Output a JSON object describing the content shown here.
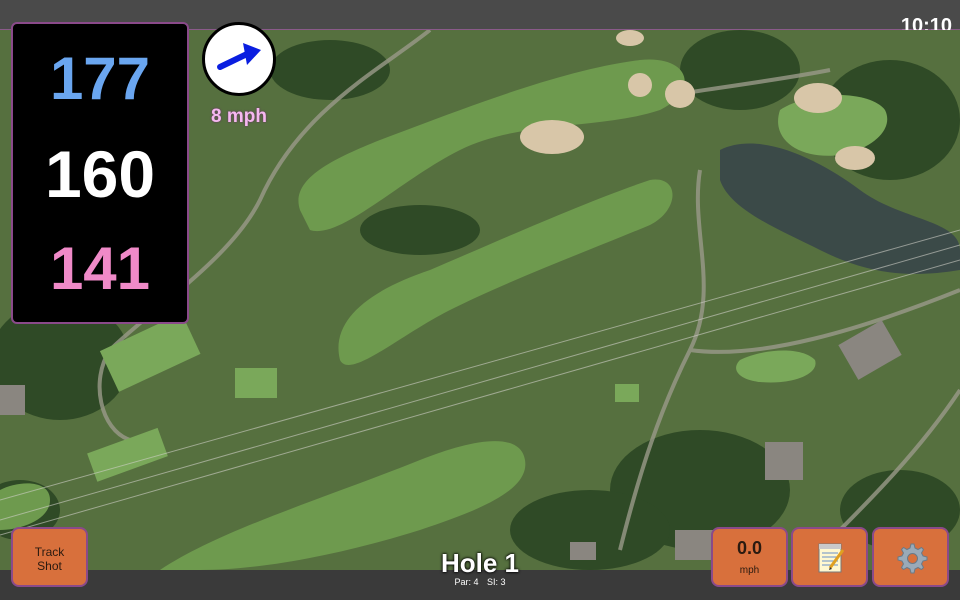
{
  "status": {
    "time": "10:10"
  },
  "distances": {
    "back": "177",
    "center": "160",
    "front": "141"
  },
  "wind": {
    "speed": "8 mph",
    "icon": "wind-arrow-icon"
  },
  "hole": {
    "title": "Hole 1",
    "par": "Par: 4",
    "si": "SI: 3"
  },
  "buttons": {
    "track_shot_line1": "Track",
    "track_shot_line2": "Shot",
    "speed_value": "0.0",
    "speed_unit": "mph",
    "notes_icon": "notepad-icon",
    "settings_icon": "gear-icon"
  },
  "colors": {
    "back": "#6aa6f0",
    "center": "#ffffff",
    "front": "#f08ac8",
    "button": "#d8703c",
    "accent_border": "#8a4a8a"
  }
}
